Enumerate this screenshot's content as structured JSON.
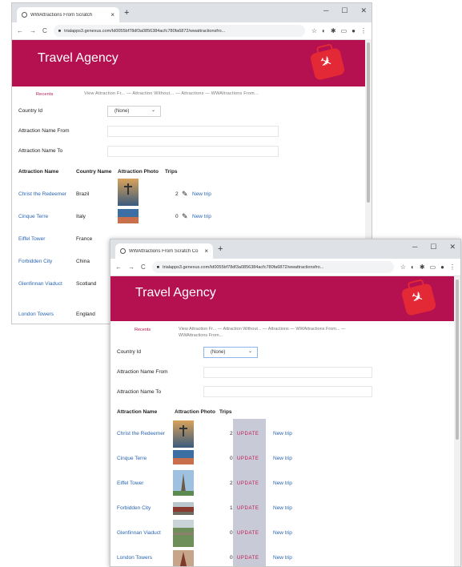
{
  "back_window": {
    "tab_title": "WWAttractions From Scratch",
    "url": "trialapps3.genexus.com/Id0055bf78df3a0856384acfc780fa6872/wwattractionsfro...",
    "header_title": "Travel Agency",
    "nav": {
      "recents": "Recents",
      "crumbs": "View Attraction Fr... — Attraction Without... — Attractions — WWAttractions From..."
    },
    "filters": {
      "country_label": "Country Id",
      "country_value": "(None)",
      "from_label": "Attraction Name From",
      "to_label": "Attraction Name To"
    },
    "columns": [
      "Attraction Name",
      "Country Name",
      "Attraction Photo",
      "Trips"
    ],
    "rows": [
      {
        "name": "Christ the Redeemer",
        "country": "Brazil",
        "trips": "2",
        "action": "New trip"
      },
      {
        "name": "Cinque Terre",
        "country": "Italy",
        "trips": "0",
        "action": "New trip"
      },
      {
        "name": "Eiffel Tower",
        "country": "France"
      },
      {
        "name": "Forbidden City",
        "country": "China"
      },
      {
        "name": "Glenfinnan Viaduct",
        "country": "Scotland"
      },
      {
        "name": "London Towers",
        "country": "England"
      }
    ]
  },
  "front_window": {
    "tab_title": "WWAttractions From Scratch Co",
    "url": "trialapps3.genexus.com/Id0055bf78df3a0856384acfc780fa6872/wwattractionsfro...",
    "header_title": "Travel Agency",
    "nav": {
      "recents": "Recents",
      "crumbs_line1": "View Attraction Fr... — Attraction Without... — Attractions — WWAttractions From... —",
      "crumbs_line2": "WWAttractions From..."
    },
    "filters": {
      "country_label": "Country Id",
      "country_value": "(None)",
      "from_label": "Attraction Name From",
      "to_label": "Attraction Name To"
    },
    "columns": [
      "Attraction Name",
      "Attraction Photo",
      "Trips"
    ],
    "update_label": "UPDATE",
    "new_trip_label": "New trip",
    "rows": [
      {
        "name": "Christ the Redeemer",
        "trips": "2"
      },
      {
        "name": "Cinque Terre",
        "trips": "0"
      },
      {
        "name": "Eiffel Tower",
        "trips": "2"
      },
      {
        "name": "Forbidden City",
        "trips": "1"
      },
      {
        "name": "Glenfinnan Viaduct",
        "trips": "0"
      },
      {
        "name": "London Towers",
        "trips": "0"
      }
    ]
  },
  "colors": {
    "header": "#b5104f",
    "link": "#2a66b3",
    "update": "#c0184e",
    "bag": "#e32836"
  }
}
